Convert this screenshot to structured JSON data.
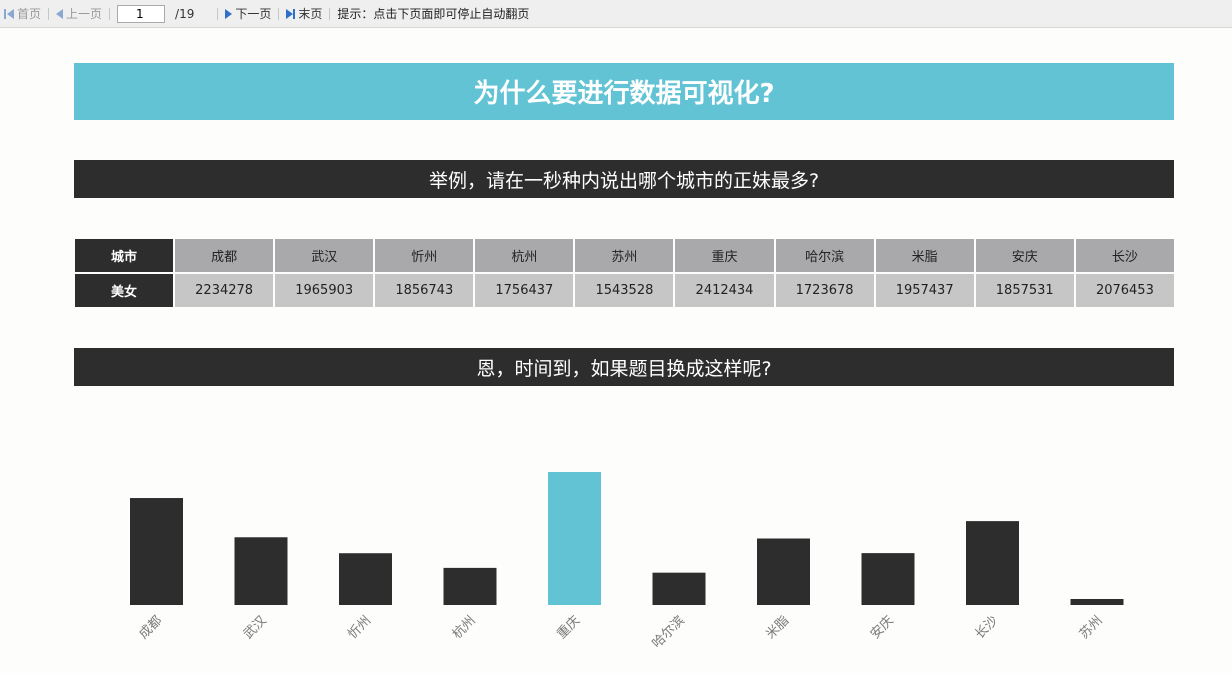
{
  "toolbar": {
    "first": "首页",
    "prev": "上一页",
    "page_value": "1",
    "page_total": "/19",
    "next": "下一页",
    "last": "末页",
    "hint": "提示：点击下页面即可停止自动翻页"
  },
  "slide": {
    "title": "为什么要进行数据可视化?",
    "subtitle1": "举例，请在一秒种内说出哪个城市的正妹最多?",
    "subtitle2": "恩，时间到，如果题目换成这样呢?"
  },
  "table": {
    "row1_label": "城市",
    "row2_label": "美女",
    "cities": [
      "成都",
      "武汉",
      "忻州",
      "杭州",
      "苏州",
      "重庆",
      "哈尔滨",
      "米脂",
      "安庆",
      "长沙"
    ],
    "values": [
      "2234278",
      "1965903",
      "1856743",
      "1756437",
      "1543528",
      "2412434",
      "1723678",
      "1957437",
      "1857531",
      "2076453"
    ]
  },
  "chart_data": {
    "type": "bar",
    "categories": [
      "成都",
      "武汉",
      "忻州",
      "杭州",
      "重庆",
      "哈尔滨",
      "米脂",
      "安庆",
      "长沙",
      "苏州"
    ],
    "values": [
      2234278,
      1965903,
      1856743,
      1756437,
      2412434,
      1723678,
      1957437,
      1857531,
      2076453,
      1543528
    ],
    "highlight_category": "重庆",
    "colors": {
      "default": "#2d2d2d",
      "highlight": "#62c3d4",
      "tick_label": "#7a7a7a"
    },
    "axis_visible": false,
    "grid": false,
    "legend": "none"
  }
}
